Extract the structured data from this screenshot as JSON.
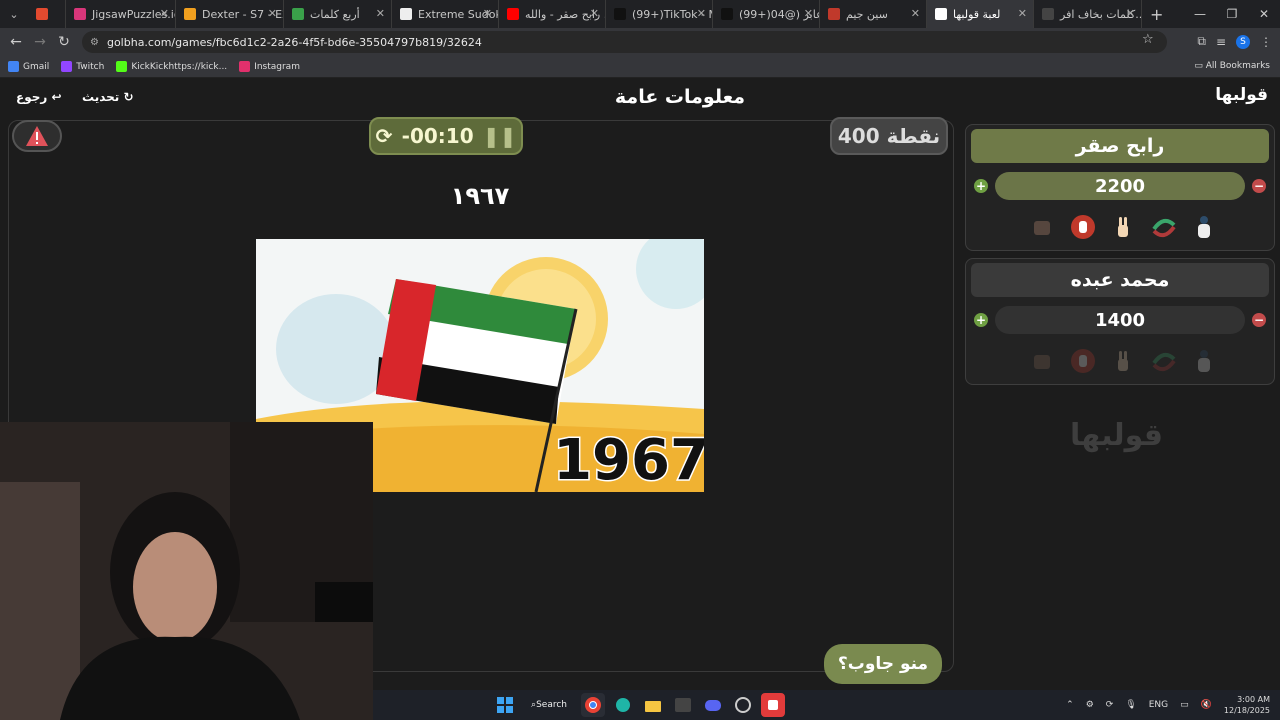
{
  "browser": {
    "tabs": [
      {
        "title": "",
        "favicon": "#e34a2f",
        "active": false
      },
      {
        "title": "JigsawPuzzles.io",
        "favicon": "#d9367a",
        "active": false
      },
      {
        "title": "Dexter - S7 - E2",
        "favicon": "#f1a01f",
        "active": false
      },
      {
        "title": "أربع كلمات",
        "favicon": "#3aa14a",
        "active": false
      },
      {
        "title": "Extreme Sudoku",
        "favicon": "#eeeeee",
        "active": false
      },
      {
        "title": "رابح صقر - والله ...",
        "favicon": "#ff0000",
        "active": false
      },
      {
        "title": "(99+)TikTok - Ma...",
        "favicon": "#111111",
        "active": false
      },
      {
        "title": "(99+)عابر (@04...",
        "favicon": "#111111",
        "active": false
      },
      {
        "title": "سين جيم",
        "favicon": "#c0392b",
        "active": false
      },
      {
        "title": "لعبة قولبها",
        "favicon": "#ffffff",
        "active": true
      },
      {
        "title": "كلمات بخاف افر...",
        "favicon": "#444444",
        "active": false
      }
    ],
    "url": "golbha.com/games/fbc6d1c2-2a26-4f5f-bd6e-35504797b819/32624",
    "profile_initial": "S",
    "bookmarks": [
      {
        "label": "Gmail",
        "color": "#4285f4"
      },
      {
        "label": "Twitch",
        "color": "#9146ff"
      },
      {
        "label": "KickKickhttps://kick...",
        "color": "#53fc18"
      },
      {
        "label": "Instagram",
        "color": "#e1306c"
      }
    ],
    "all_bookmarks": "All Bookmarks"
  },
  "game": {
    "back_label": "رجوع",
    "refresh_label": "تحديث",
    "category": "معلومات عامة",
    "logo": "قولبها",
    "timer": "-00:10",
    "points": "400 نقطة",
    "question": "١٩٦٧",
    "image_caption": "1967",
    "answer_button": "منو جاوب؟",
    "teams": [
      {
        "name": "رابح صقر",
        "score": "2200",
        "active": true
      },
      {
        "name": "محمد عبده",
        "score": "1400",
        "active": false
      }
    ],
    "side_logo": "قولبها"
  },
  "taskbar": {
    "search_label": "Search",
    "language": "ENG",
    "time": "3:00 AM",
    "date": "12/18/2025"
  }
}
